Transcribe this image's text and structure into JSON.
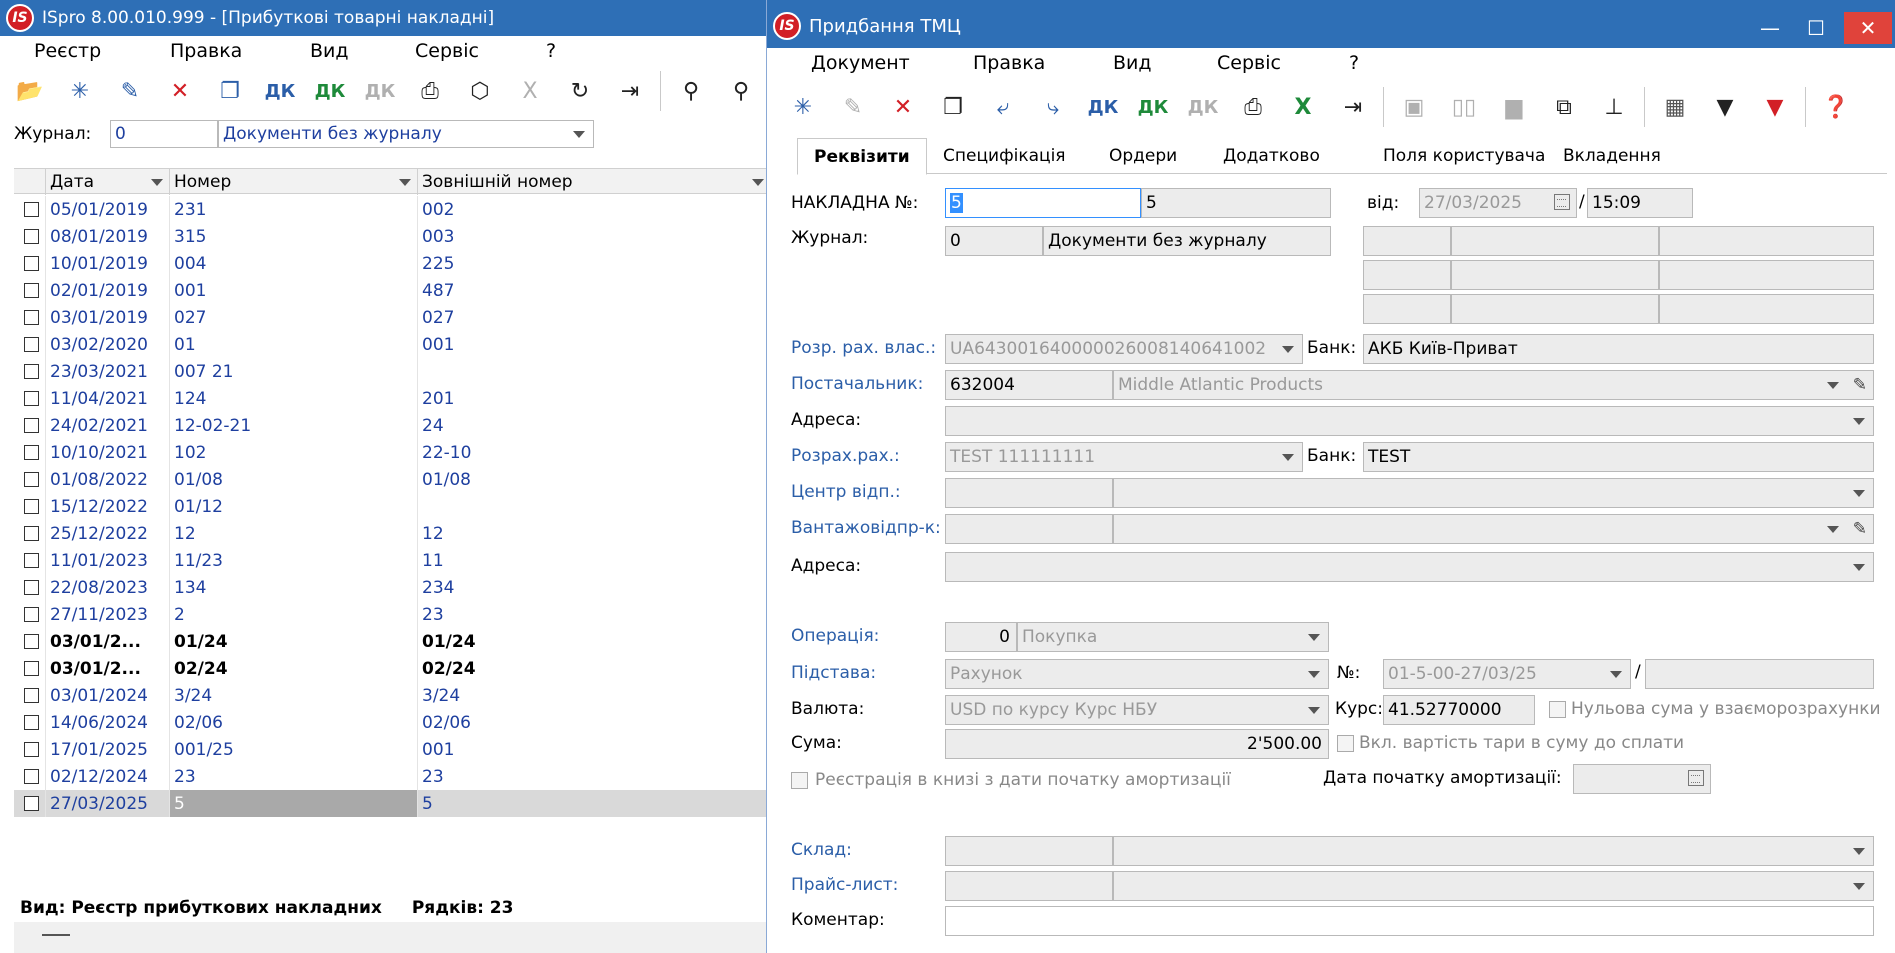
{
  "left": {
    "title": "ISpro 8.00.010.999 - [Прибуткові товарні накладні]",
    "logo": "IS",
    "menu": [
      "Реєстр",
      "Правка",
      "Вид",
      "Сервіс",
      "?"
    ],
    "toolbar_icons": [
      "folder-open-icon",
      "new-document-icon",
      "edit-document-icon",
      "delete-document-icon",
      "copy-document-icon",
      "debit-credit-icon",
      "debit-credit-post-icon",
      "debit-credit-disabled-icon",
      "print-icon",
      "package-icon",
      "excel-export-disabled-icon",
      "refresh-icon",
      "exit-icon",
      "search-icon",
      "search-next-icon"
    ],
    "journal": {
      "label": "Журнал:",
      "code": "0",
      "name": "Документи без журналу"
    },
    "grid": {
      "columns": [
        "Дата",
        "Номер",
        "Зовнішній номер"
      ],
      "rows": [
        {
          "date": "05/01/2019",
          "number": "231",
          "ext": "002",
          "style": "normal"
        },
        {
          "date": "08/01/2019",
          "number": "315",
          "ext": "003",
          "style": "normal"
        },
        {
          "date": "10/01/2019",
          "number": "004",
          "ext": "225",
          "style": "normal"
        },
        {
          "date": "02/01/2019",
          "number": "001",
          "ext": "487",
          "style": "normal"
        },
        {
          "date": "03/01/2019",
          "number": "027",
          "ext": "027",
          "style": "normal"
        },
        {
          "date": "03/02/2020",
          "number": "01",
          "ext": "001",
          "style": "normal"
        },
        {
          "date": "23/03/2021",
          "number": "007 21",
          "ext": "",
          "style": "normal"
        },
        {
          "date": "11/04/2021",
          "number": "124",
          "ext": "201",
          "style": "normal"
        },
        {
          "date": "24/02/2021",
          "number": "12-02-21",
          "ext": "24",
          "style": "normal"
        },
        {
          "date": "10/10/2021",
          "number": "102",
          "ext": "22-10",
          "style": "normal"
        },
        {
          "date": "01/08/2022",
          "number": "01/08",
          "ext": "01/08",
          "style": "normal"
        },
        {
          "date": "15/12/2022",
          "number": "01/12",
          "ext": "",
          "style": "normal"
        },
        {
          "date": "25/12/2022",
          "number": "12",
          "ext": "12",
          "style": "normal"
        },
        {
          "date": "11/01/2023",
          "number": "11/23",
          "ext": "11",
          "style": "normal"
        },
        {
          "date": "22/08/2023",
          "number": "134",
          "ext": "234",
          "style": "normal"
        },
        {
          "date": "27/11/2023",
          "number": "2",
          "ext": "23",
          "style": "normal"
        },
        {
          "date": "03/01/2...",
          "number": "01/24",
          "ext": "01/24",
          "style": "bold"
        },
        {
          "date": "03/01/2...",
          "number": "02/24",
          "ext": "02/24",
          "style": "bold"
        },
        {
          "date": "03/01/2024",
          "number": "3/24",
          "ext": "3/24",
          "style": "normal"
        },
        {
          "date": "14/06/2024",
          "number": "02/06",
          "ext": "02/06",
          "style": "normal"
        },
        {
          "date": "17/01/2025",
          "number": "001/25",
          "ext": "001",
          "style": "normal"
        },
        {
          "date": "02/12/2024",
          "number": "23",
          "ext": "23",
          "style": "normal"
        },
        {
          "date": "27/03/2025",
          "number": "5",
          "ext": "5",
          "style": "selected"
        }
      ]
    },
    "status": {
      "view": "Вид: Реєстр прибуткових накладних",
      "rows": "Рядків: 23"
    }
  },
  "right": {
    "title": "Придбання ТМЦ",
    "logo": "IS",
    "menu": [
      "Документ",
      "Правка",
      "Вид",
      "Сервіс",
      "?"
    ],
    "toolbar_icons": [
      "new-document-icon",
      "edit-disabled-icon",
      "delete-document-icon",
      "copy-document-icon",
      "import-icon",
      "export-icon",
      "debit-credit-icon",
      "debit-credit-post-icon",
      "debit-credit-disabled-icon",
      "print-preview-icon",
      "excel-export-icon",
      "exit-icon",
      "save-disabled-icon",
      "book-disabled-icon",
      "folder-disabled-icon",
      "link-icon",
      "hierarchy-icon",
      "grid-icon",
      "filter-icon",
      "filter-clear-icon",
      "help-icon"
    ],
    "tabs": [
      "Реквізити",
      "Специфікація",
      "Ордери",
      "Додатково",
      "Поля користувача",
      "Вкладення"
    ],
    "form": {
      "invoice_label": "НАКЛАДНА №:",
      "invoice_number": "5",
      "invoice_number2": "5",
      "from_label": "від:",
      "date": "27/03/2025",
      "time_sep": "/",
      "time": "15:09",
      "journal_label": "Журнал:",
      "journal_code": "0",
      "journal_name": "Документи без журналу",
      "own_account_label": "Розр. рах. влас.:",
      "own_account": "UA643001640000026008140641002",
      "bank_label": "Банк:",
      "own_bank": "АКБ Київ-Приват",
      "supplier_label": "Постачальник:",
      "supplier_code": "632004",
      "supplier_name": "Middle Atlantic Products",
      "address_label": "Адреса:",
      "supplier_account_label": "Розрах.рах.:",
      "supplier_account": "TEST 111111111",
      "supplier_bank": "TEST",
      "resp_center_label": "Центр відп.:",
      "shipper_label": "Вантажовідпр-к:",
      "address2_label": "Адреса:",
      "operation_label": "Операція:",
      "operation_code": "0",
      "operation_name": "Покупка",
      "basis_label": "Підстава:",
      "basis": "Рахунок",
      "no_label": "№:",
      "basis_number": "01-5-00-27/03/25",
      "basis_sep": "/",
      "currency_label": "Валюта:",
      "currency": "USD по курсу Курс НБУ",
      "rate_label": "Курс:",
      "rate": "41.52770000",
      "zero_sum_label": "Нульова сума у взаєморозрахунки",
      "sum_label": "Сума:",
      "sum": "2'500.00",
      "tare_label": "Вкл. вартість тари в суму до сплати",
      "register_label": "Реєстрація в книзі з дати початку амортизації",
      "amort_date_label": "Дата початку амортизації:",
      "warehouse_label": "Склад:",
      "pricelist_label": "Прайс-лист:",
      "comment_label": "Коментар:"
    }
  }
}
